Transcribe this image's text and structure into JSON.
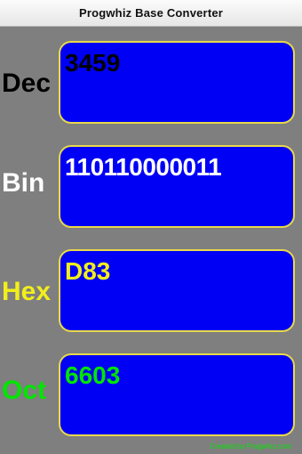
{
  "app": {
    "title": "Progwhiz Base Converter"
  },
  "colors": {
    "dec_label": "#000000",
    "bin_label": "#ffffff",
    "hex_label": "#f2ef1a",
    "oct_label": "#00e600",
    "dec_value": "#000000",
    "bin_value": "#ffffff",
    "hex_value": "#f2ef1a",
    "oct_value": "#00e600",
    "box_fill": "#0000f5",
    "box_border": "#e8d94a",
    "footer": "#00e600"
  },
  "rows": {
    "dec": {
      "label": "Dec",
      "value": "3459"
    },
    "bin": {
      "label": "Bin",
      "value": "110110000011"
    },
    "hex": {
      "label": "Hex",
      "value": "D83"
    },
    "oct": {
      "label": "Oct",
      "value": "6603"
    }
  },
  "footer": {
    "credit": "Created by Progwhiz.com"
  }
}
